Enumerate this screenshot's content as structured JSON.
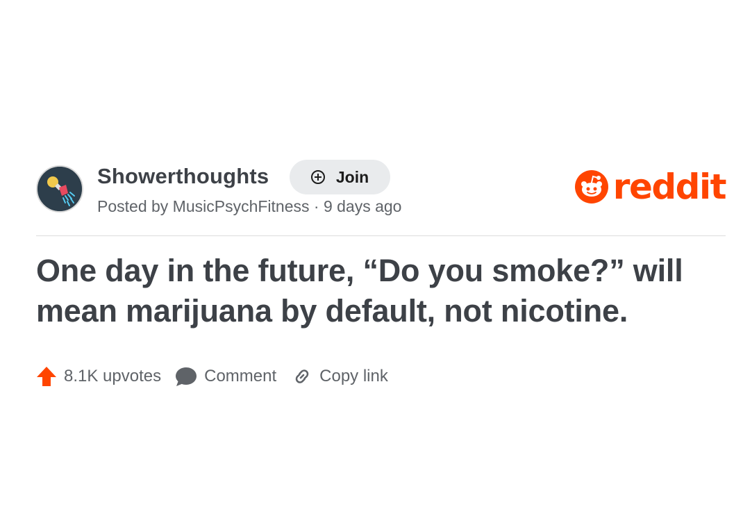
{
  "post": {
    "subreddit": "Showerthoughts",
    "join_label": "Join",
    "meta": "Posted by MusicPsychFitness · 9 days ago",
    "title": "One day in the future, “Do you smoke?” will mean marijuana by default, not nicotine."
  },
  "brand": {
    "wordmark": "reddit",
    "color": "#ff4500"
  },
  "actions": {
    "upvotes": "8.1K upvotes",
    "comment": "Comment",
    "copy_link": "Copy link"
  },
  "icons": {
    "avatar": "lightbulb-shower-icon",
    "join": "plus-circle-icon",
    "logo": "reddit-alien-icon",
    "upvote": "arrow-up-icon",
    "comment": "speech-bubble-icon",
    "copy": "link-icon"
  }
}
